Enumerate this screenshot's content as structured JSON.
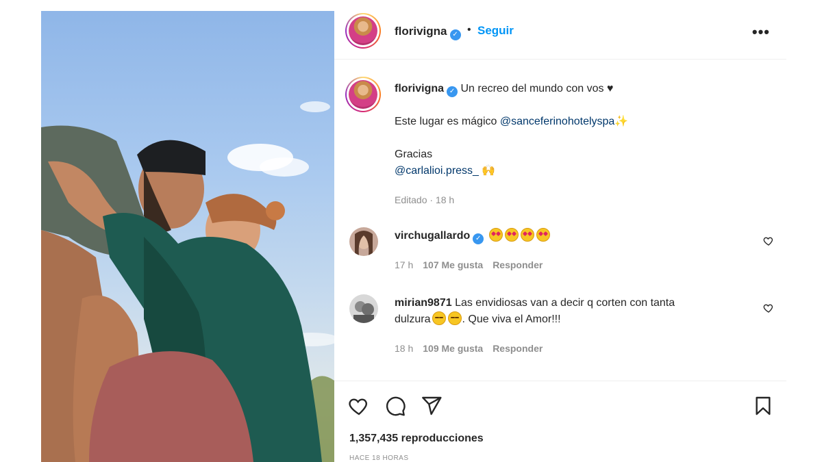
{
  "post": {
    "author": "florivigna",
    "verified_icon": "verified-badge-icon",
    "dot": "•",
    "follow_label": "Seguir",
    "more_label": "•••"
  },
  "caption": {
    "username": "florivigna",
    "line1": "Un recreo del mundo con vos ♥",
    "line2_prefix": "Este lugar es mágico ",
    "line2_mention": "@sanceferinohotelyspa",
    "line2_emoji": "✨",
    "line3": "Gracias",
    "line4_mention": "@carlalioi.press_",
    "line4_emoji": "🙌",
    "meta": "Editado · 18 h"
  },
  "comments": [
    {
      "username": "virchugallardo",
      "verified": true,
      "emoji_count": 4,
      "emoji_name": "star-struck-face",
      "time": "17 h",
      "likes": "107 Me gusta",
      "reply": "Responder"
    },
    {
      "username": "mirian9871",
      "verified": false,
      "text_line1": "Las envidiosas van a decir q corten con tanta",
      "text_line2_prefix": "dulzura",
      "text_line2_suffix": ". Que viva el Amor!!!",
      "emoji_name": "laughing-face",
      "time": "18 h",
      "likes": "109 Me gusta",
      "reply": "Responder"
    }
  ],
  "actions": {
    "icons": [
      "heart-icon",
      "comment-icon",
      "share-icon",
      "bookmark-icon"
    ],
    "views": "1,357,435 reproducciones",
    "posted_ago": "HACE 18 HORAS"
  },
  "colors": {
    "link_blue": "#0095f6",
    "verified_blue": "#3897f0",
    "mention": "#00376b",
    "muted": "#8e8e8e"
  }
}
